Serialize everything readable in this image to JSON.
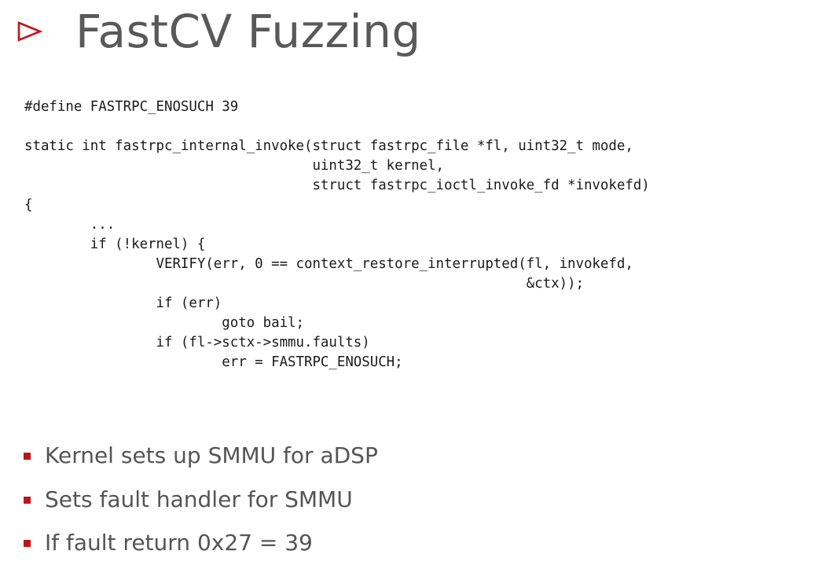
{
  "slide": {
    "title": "FastCV Fuzzing",
    "accent_color": "#c0141c",
    "title_marker_icon": "triangle-right-outline-icon"
  },
  "code": {
    "lines": [
      "#define FASTRPC_ENOSUCH 39",
      "",
      "static int fastrpc_internal_invoke(struct fastrpc_file *fl, uint32_t mode,",
      "                                   uint32_t kernel,",
      "                                   struct fastrpc_ioctl_invoke_fd *invokefd)",
      "{",
      "        ...",
      "        if (!kernel) {",
      "                VERIFY(err, 0 == context_restore_interrupted(fl, invokefd,",
      "                                                             &ctx));",
      "                if (err)",
      "                        goto bail;",
      "                if (fl->sctx->smmu.faults)",
      "                        err = FASTRPC_ENOSUCH;"
    ]
  },
  "bullets": [
    "Kernel sets up SMMU for aDSP",
    "Sets fault handler for SMMU",
    "If fault return 0x27 = 39"
  ]
}
